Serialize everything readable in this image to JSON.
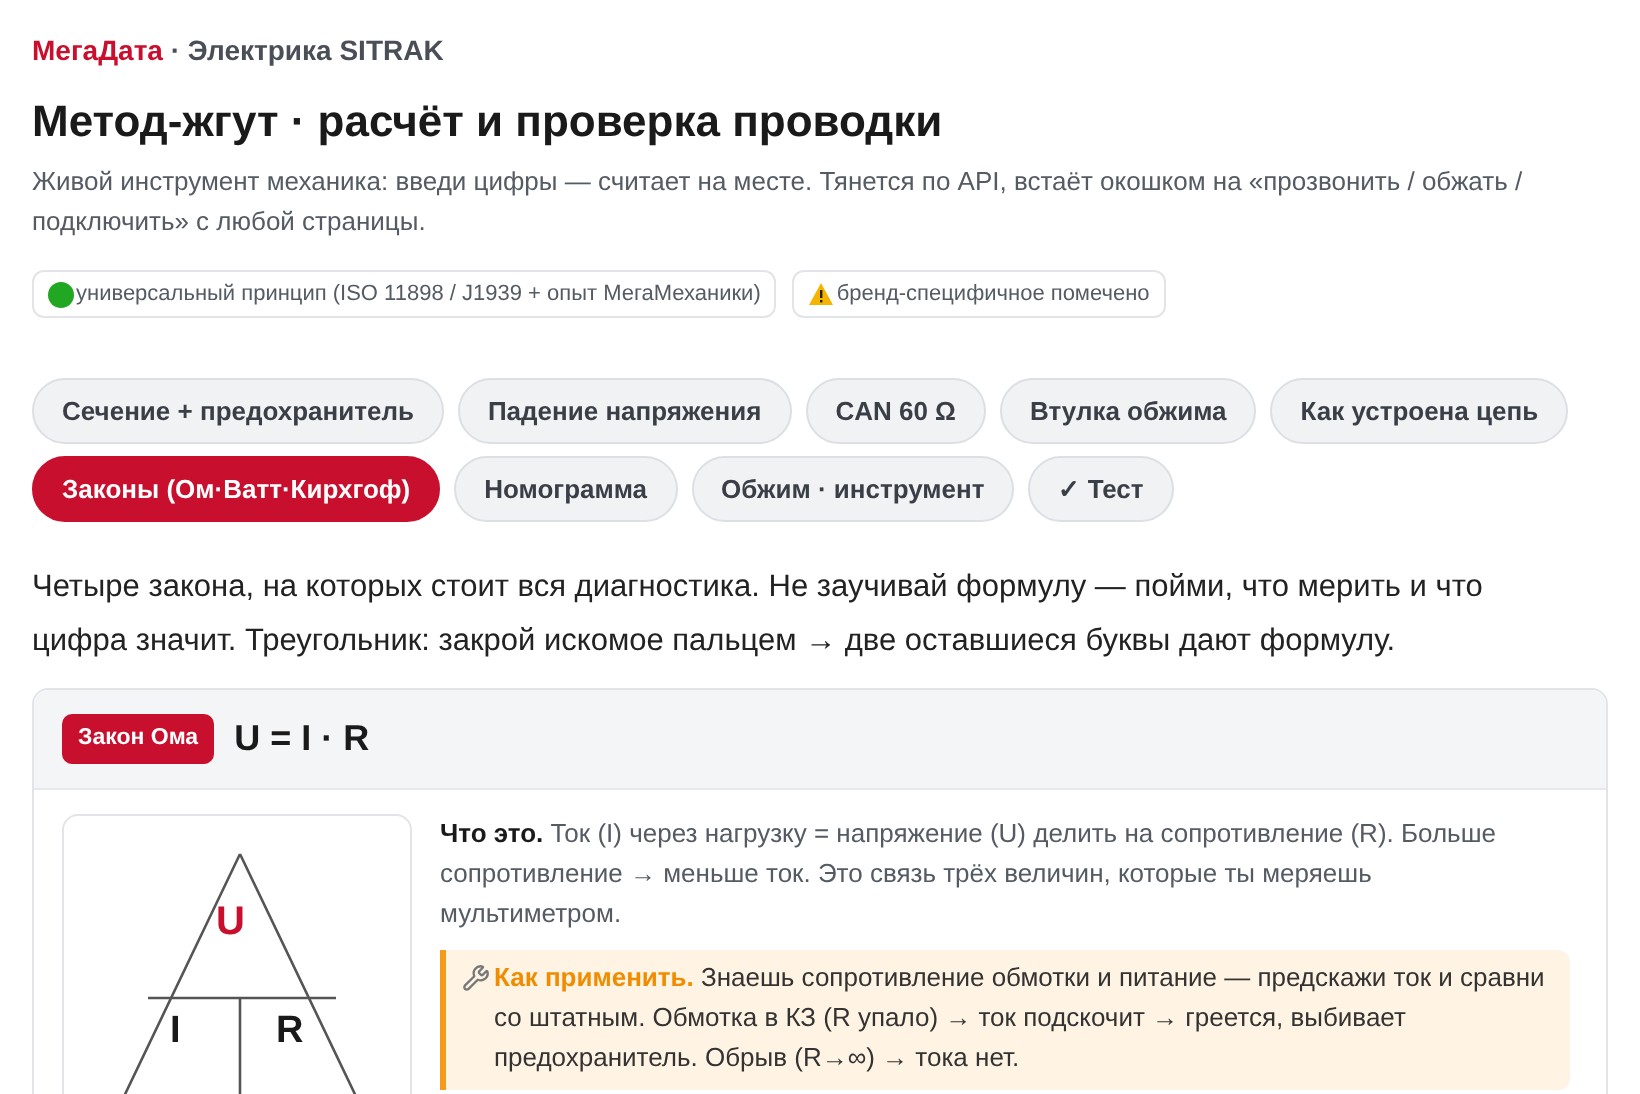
{
  "header": {
    "brand": "МегаДата",
    "section": "· Электрика SITRAK",
    "title": "Метод-жгут · расчёт и проверка проводки",
    "description": "Живой инструмент механика: введи цифры — считает на месте. Тянется по API, встаёт окошком на «прозвонить / обжать / подключить» с любой страницы."
  },
  "badges": [
    {
      "kind": "universal",
      "label": "универсальный принцип (ISO 11898 / J1939 + опыт МегаМеханики)"
    },
    {
      "kind": "warning",
      "label": "бренд-специфичное помечено"
    }
  ],
  "tabs": [
    {
      "label": "Сечение + предохранитель",
      "selected": false
    },
    {
      "label": "Падение напряжения",
      "selected": false
    },
    {
      "label": "CAN 60 Ω",
      "selected": false
    },
    {
      "label": "Втулка обжима",
      "selected": false
    },
    {
      "label": "Как устроена цепь",
      "selected": false
    },
    {
      "label": "Законы (Ом·Ватт·Кирхгоф)",
      "selected": true
    },
    {
      "label": "Номограмма",
      "selected": false
    },
    {
      "label": "Обжим · инструмент",
      "selected": false
    },
    {
      "label": "✓ Тест",
      "selected": false
    }
  ],
  "intro": "Четыре закона, на которых стоит вся диагностика. Не заучивай формулу — пойми, что мерить и что цифра значит. Треугольник: закрой искомое пальцем → две оставшиеся буквы дают формулу.",
  "law_card": {
    "tag": "Закон Ома",
    "formula": "U = I · R",
    "triangle": {
      "top": "U",
      "bottom_left": "I",
      "bottom_right": "R"
    },
    "what": "**Что это.** Ток (I) через нагрузку = напряжение (U) делить на сопротивление (R). Больше сопротивление → меньше ток. Это связь трёх величин, которые ты меряешь мультиметром.",
    "how": "**Как применить.** Знаешь сопротивление обмотки и питание — предскажи ток и сравни со штатным. Обмотка в КЗ (R упало) → ток подскочит → греется, выбивает предохранитель. Обрыв (R→∞) → тока нет."
  }
}
